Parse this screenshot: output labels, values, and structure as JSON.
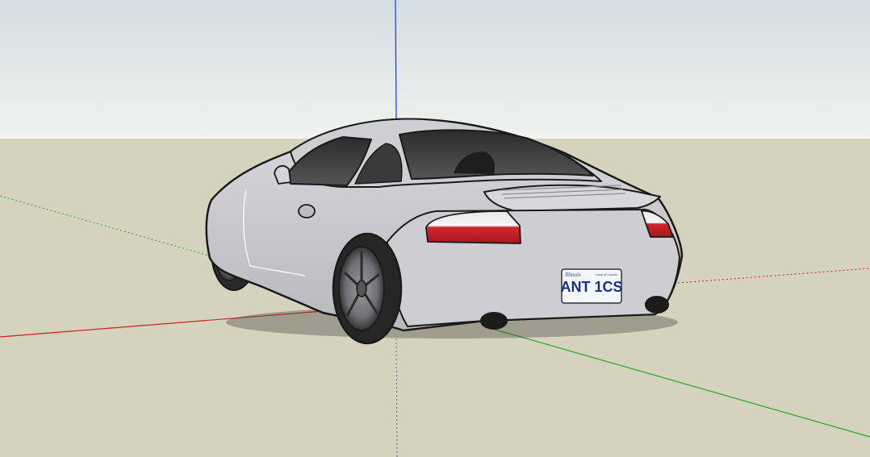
{
  "scene": {
    "sky_top_color": "#d6dfe2",
    "sky_bottom_color": "#eef2ee",
    "ground_color": "#d5d3bd",
    "axes": {
      "red_color": "#cc2222",
      "green_color": "#22aa22",
      "blue_color": "#2233cc"
    },
    "car": {
      "body_color": "#c8c7cb",
      "taillight_color": "#d1262d",
      "license_plate": {
        "state": "Illinois",
        "tagline": "Land of Lincoln",
        "number": "ANT 1CS"
      }
    }
  }
}
